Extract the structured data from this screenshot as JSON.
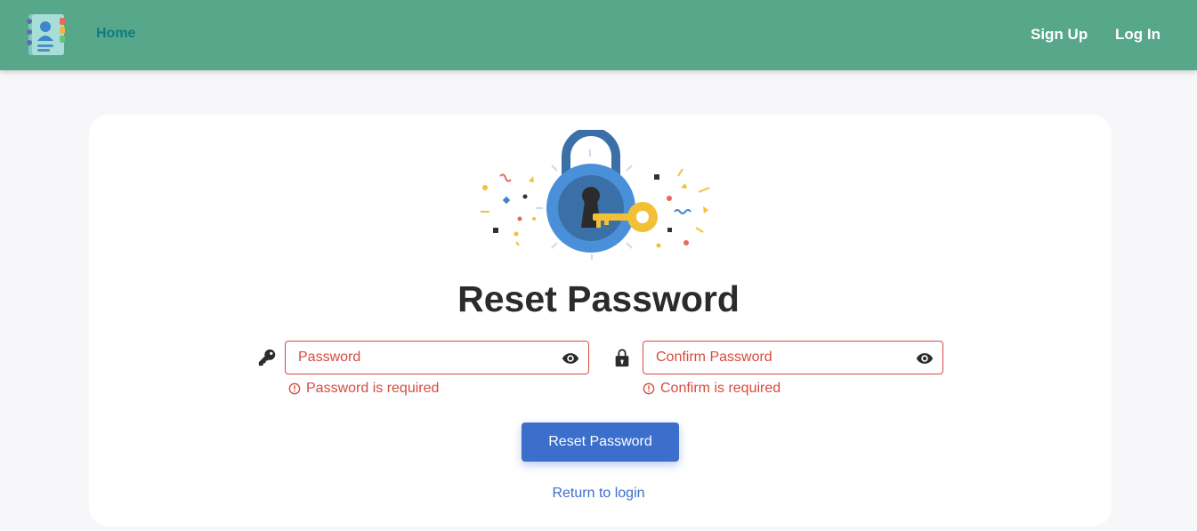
{
  "navbar": {
    "logo_icon": "address-book-icon",
    "home_label": "Home",
    "signup_label": "Sign Up",
    "login_label": "Log In",
    "background_color": "#57a78b"
  },
  "form": {
    "illustration_icon": "padlock-with-key-icon",
    "title": "Reset Password",
    "password": {
      "icon": "key-icon",
      "placeholder": "Password",
      "value": "",
      "error": "Password is required"
    },
    "confirm": {
      "icon": "lock-icon",
      "placeholder": "Confirm Password",
      "value": "",
      "error": "Confirm is required"
    },
    "submit_label": "Reset Password",
    "return_link": "Return to login"
  },
  "colors": {
    "accent": "#3b6fcb",
    "error": "#d64b3f"
  }
}
